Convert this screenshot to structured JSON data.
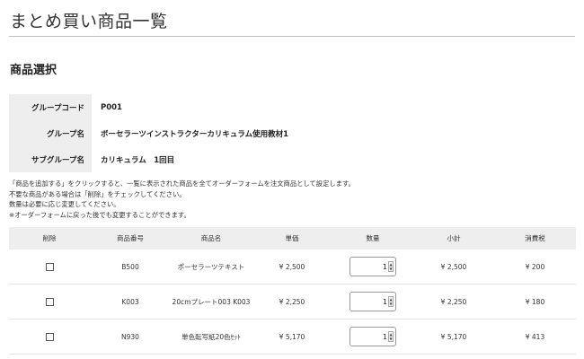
{
  "page": {
    "title": "まとめ買い商品一覧",
    "section_title": "商品選択"
  },
  "group_info": [
    {
      "label": "グループコード",
      "value": "P001"
    },
    {
      "label": "グループ名",
      "value": "ボーセラーツインストラクターカリキュラム使用教材1"
    },
    {
      "label": "サブグループ名",
      "value": "カリキュラム　1回目"
    }
  ],
  "notes": [
    "「商品を追加する」をクリックすると、一覧に表示された商品を全てオーダーフォームを注文商品として設定します。",
    "不要な商品がある場合は「削除」をチェックしてください。",
    "数量は必要に応じ変更してください。",
    "※オーダーフォームに戻った後でも変更することができます。"
  ],
  "table": {
    "headers": {
      "delete": "削除",
      "code": "商品番号",
      "name": "商品名",
      "price": "単価",
      "qty": "数量",
      "subtotal": "小計",
      "tax": "消費税"
    },
    "rows": [
      {
        "checked": false,
        "code": "B500",
        "name": "ポーセラーツテキスト",
        "price": "¥ 2,500",
        "qty": "1",
        "subtotal": "¥ 2,500",
        "tax": "¥ 200"
      },
      {
        "checked": false,
        "code": "K003",
        "name": "20cmプレート003 K003",
        "price": "¥ 2,250",
        "qty": "1",
        "subtotal": "¥ 2,250",
        "tax": "¥ 180"
      },
      {
        "checked": false,
        "code": "N930",
        "name": "単色転写紙20色ｾｯﾄ",
        "price": "¥ 5,170",
        "qty": "1",
        "subtotal": "¥ 5,170",
        "tax": "¥ 413"
      }
    ]
  }
}
